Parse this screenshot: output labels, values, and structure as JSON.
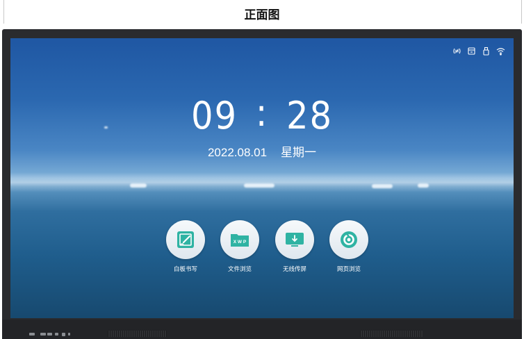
{
  "caption": "正面图",
  "status_icons": [
    "nfc-signal-icon",
    "storage-icon",
    "usb-icon",
    "wifi-icon"
  ],
  "clock": {
    "hours": "09",
    "separator": ":",
    "minutes": "28"
  },
  "date": {
    "date": "2022.08.01",
    "weekday": "星期一"
  },
  "apps": [
    {
      "label": "白板书写",
      "icon": "whiteboard-icon"
    },
    {
      "label": "文件浏览",
      "icon": "file-browser-icon"
    },
    {
      "label": "无线传屏",
      "icon": "wireless-cast-icon"
    },
    {
      "label": "网页浏览",
      "icon": "web-browser-icon"
    }
  ],
  "colors": {
    "bezel": "#2a2b2e",
    "icon_teal": "#2fb3a3",
    "sky": "#2b68b0",
    "sea": "#1f5d8c"
  }
}
